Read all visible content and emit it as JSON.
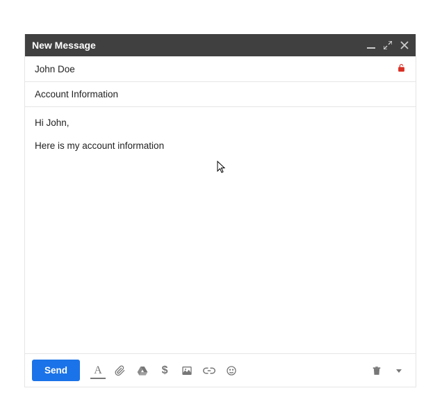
{
  "header": {
    "title": "New Message"
  },
  "fields": {
    "to": "John Doe",
    "subject": "Account Information"
  },
  "body": {
    "line1": "Hi John,",
    "line2": "Here is my account information"
  },
  "toolbar": {
    "send_label": "Send",
    "dollar": "$"
  },
  "colors": {
    "header_bg": "#404040",
    "send_bg": "#1a73e8",
    "lock": "#d93025"
  }
}
